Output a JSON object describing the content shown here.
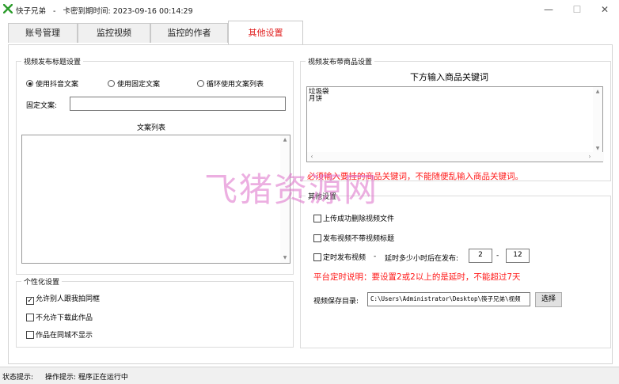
{
  "window": {
    "app_name": "快子兄弟",
    "separator": "-",
    "expiry_label": "卡密到期时间:",
    "expiry_value": "2023-09-16 00:14:29",
    "minimize": "—",
    "maximize": "☐",
    "close": "✕"
  },
  "tabs": [
    {
      "label": "账号管理",
      "active": false
    },
    {
      "label": "监控视频",
      "active": false
    },
    {
      "label": "监控的作者",
      "active": false
    },
    {
      "label": "其他设置",
      "active": true
    }
  ],
  "title_settings": {
    "group_title": "视频发布标题设置",
    "radios": [
      {
        "label": "使用抖音文案",
        "checked": true
      },
      {
        "label": "使用固定文案",
        "checked": false
      },
      {
        "label": "循环使用文案列表",
        "checked": false
      }
    ],
    "fixed_text_label": "固定文案:",
    "fixed_text_value": "",
    "list_label": "文案列表"
  },
  "personal": {
    "group_title": "个性化设置",
    "checkboxes": [
      {
        "label": "允许别人跟我拍同框",
        "checked": true
      },
      {
        "label": "不允许下载此作品",
        "checked": false
      },
      {
        "label": "作品在同城不显示",
        "checked": false
      }
    ]
  },
  "product": {
    "group_title": "视频发布带商品设置",
    "header": "下方输入商品关键词",
    "keywords": [
      "垃圾袋",
      "月饼"
    ],
    "warning": "必须输入要挂的商品关键词，不能随便乱输入商品关键词。"
  },
  "other": {
    "group_title": "其他设置",
    "checkboxes": [
      {
        "label": "上传成功删除视频文件",
        "checked": false
      },
      {
        "label": "发布视频不带视频标题",
        "checked": false
      },
      {
        "label": "定时发布视频",
        "checked": false
      }
    ],
    "delay_dash": "-",
    "delay_label": "延时多少小时后在发布:",
    "delay_from": "2",
    "range_dash": "-",
    "delay_to": "12",
    "platform_note": "平台定时说明：要设置2或2以上的是延时，不能超过7天",
    "save_dir_label": "视频保存目录:",
    "save_dir_value": "C:\\Users\\Administrator\\Desktop\\筷子兄弟\\视频",
    "choose_button": "选择"
  },
  "status": {
    "label": "状态提示:",
    "message": "操作提示: 程序正在运行中"
  },
  "watermark": "飞猪资源网"
}
